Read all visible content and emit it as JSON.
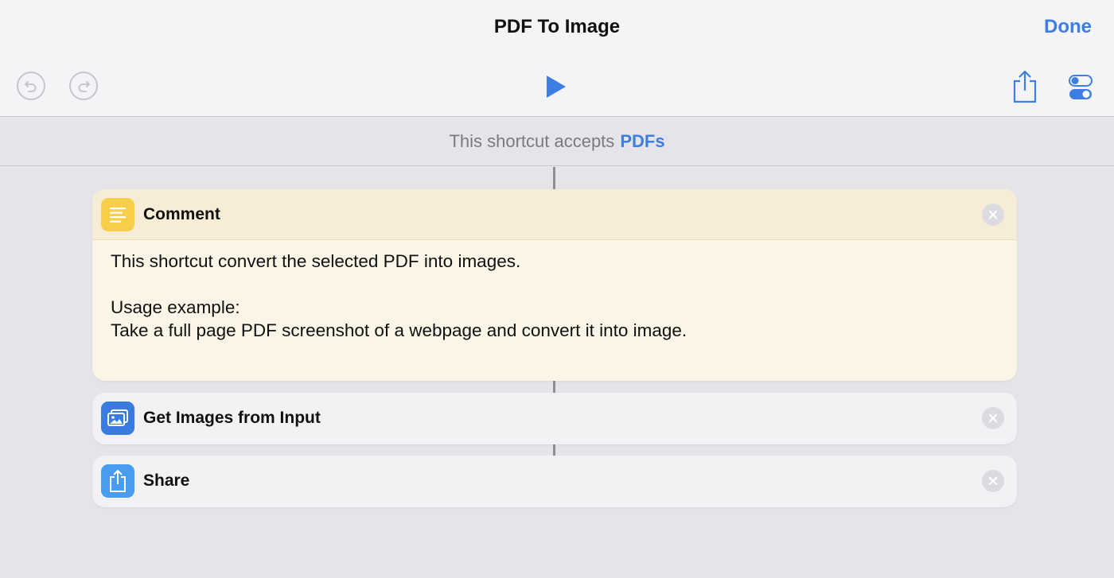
{
  "header": {
    "title": "PDF To Image",
    "done_label": "Done"
  },
  "toolbar": {
    "undo_icon": "undo-icon",
    "redo_icon": "redo-icon",
    "run_icon": "play-icon",
    "share_icon": "share-icon",
    "settings_icon": "toggle-settings-icon"
  },
  "accepts": {
    "prefix": "This shortcut accepts",
    "type": "PDFs"
  },
  "actions": [
    {
      "title": "Comment",
      "icon": "comment-lines-icon",
      "body": "This shortcut convert the selected PDF into images.\n\nUsage example:\nTake a full page PDF screenshot of a webpage and convert it into image."
    },
    {
      "title": "Get Images from Input",
      "icon": "photos-icon"
    },
    {
      "title": "Share",
      "icon": "share-icon"
    }
  ],
  "colors": {
    "accent": "#3d7ee2",
    "comment_icon": "#f8cf49",
    "comment_background": "#faf5e6"
  }
}
